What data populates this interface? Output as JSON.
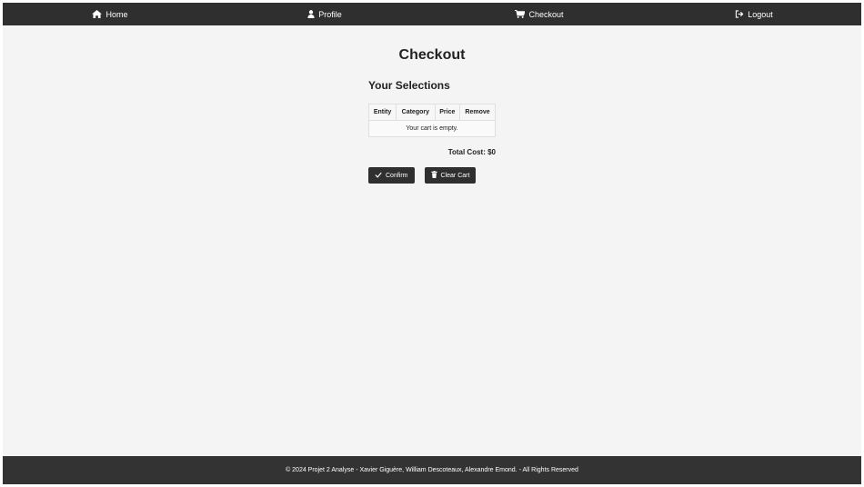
{
  "nav": {
    "home": {
      "label": "Home",
      "icon": "home-icon"
    },
    "profile": {
      "label": "Profile",
      "icon": "user-icon"
    },
    "checkout": {
      "label": "Checkout",
      "icon": "cart-icon"
    },
    "logout": {
      "label": "Logout",
      "icon": "logout-icon"
    }
  },
  "page": {
    "title": "Checkout",
    "section_title": "Your Selections"
  },
  "cart_table": {
    "columns": [
      "Entity",
      "Category",
      "Price",
      "Remove"
    ],
    "empty_message": "Your cart is empty."
  },
  "total": {
    "label": "Total Cost: $0"
  },
  "actions": {
    "confirm": {
      "label": "Confirm",
      "icon": "check-icon"
    },
    "clear": {
      "label": "Clear Cart",
      "icon": "trash-icon"
    }
  },
  "footer": {
    "text": "© 2024 Projet 2 Analyse - Xavier Giguère, William Descoteaux, Alexandre Emond. - All Rights Reserved"
  },
  "colors": {
    "navbar_bg": "#2f2f2f",
    "page_bg": "#f4f4f4",
    "button_bg": "#2f2f2f",
    "footer_bg": "#333333"
  }
}
